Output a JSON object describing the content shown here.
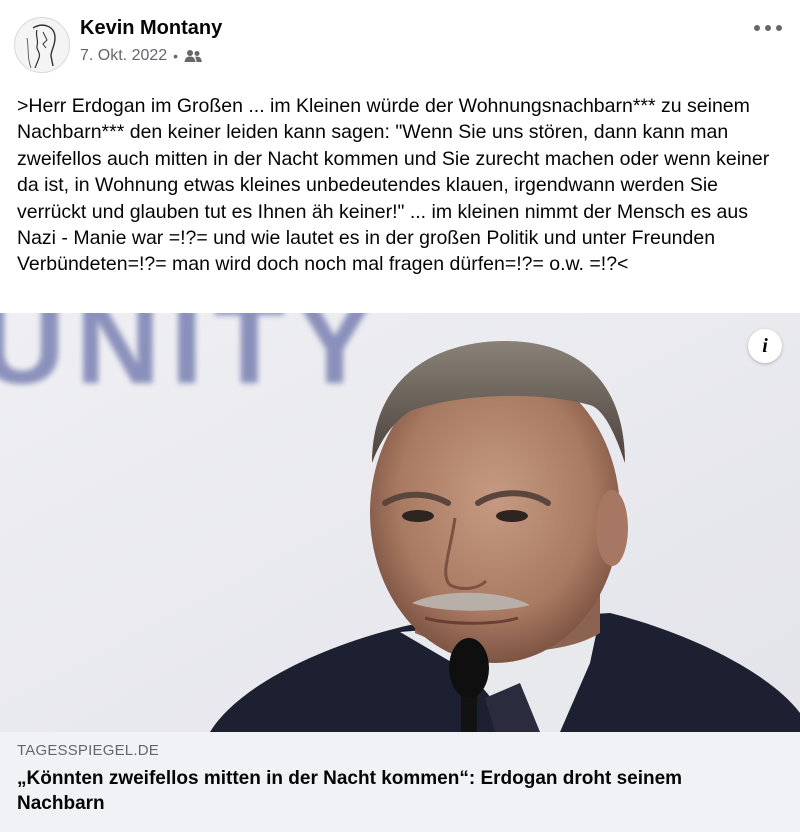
{
  "post": {
    "author_name": "Kevin Montany",
    "date": "7. Okt. 2022",
    "separator": "•",
    "audience_icon": "friends-icon",
    "more_icon": "more-options-icon",
    "text": ">Herr Erdogan im Großen ... im Kleinen würde der Wohnungsnachbarn*** zu seinem Nachbarn*** den keiner leiden kann sagen: \"Wenn Sie uns stören, dann kann man zweifellos auch mitten in der Nacht kommen und Sie zurecht machen oder wenn keiner da ist, in Wohnung etwas kleines unbedeutendes klauen, irgendwann werden Sie verrückt und glauben tut es Ihnen äh keiner!\" ... im kleinen nimmt der Mensch es aus Nazi - Manie war =!?= und wie lautet es in der großen Politik und unter Freunden Verbündeten=!?= man wird doch noch mal fragen dürfen=!?= o.w. =!?<"
  },
  "link_preview": {
    "info_label": "i",
    "domain": "TAGESSPIEGEL.DE",
    "headline": "„Könnten zweifellos mitten in der Nacht kommen“: Erdogan droht seinem Nachbarn",
    "image_backdrop_text": "UNITY"
  },
  "colors": {
    "secondary_text": "#65676b",
    "caption_bg": "#f0f2f5",
    "backdrop_text": "#2f3a8c"
  }
}
